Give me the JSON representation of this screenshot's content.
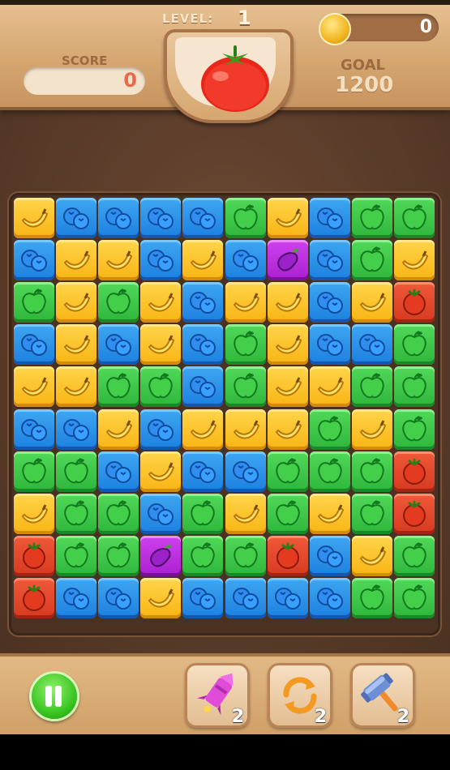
{
  "hud": {
    "level_label": "LEVEL:",
    "level": "1",
    "coins": "0",
    "score_label": "SCORE",
    "score": "0",
    "goal_label": "GOAL",
    "goal": "1200",
    "goal_item": "tomato-icon"
  },
  "board": {
    "columns": 10,
    "rows": 10,
    "legend": {
      "B": "banana",
      "U": "blueberry",
      "A": "apple",
      "T": "tomato",
      "E": "eggplant"
    },
    "colors": {
      "banana": "#f8b413",
      "blueberry": "#1c7fe0",
      "apple": "#2db63b",
      "tomato": "#d63a20",
      "eggplant": "#a91fcf"
    },
    "grid": [
      "BUUUUABUAA",
      "UBBUBUEUAB",
      "ABABUBBUBT",
      "UBUBUABUUA",
      "BBAAUABBAA",
      "UUBUBBBABA",
      "AAUBUUAAAT",
      "BAAUABABAT",
      "TAAEAATUBA",
      "TUUBUUUUAA"
    ]
  },
  "controls": {
    "pause_icon": "pause-icon",
    "boosters": [
      {
        "icon": "rocket-icon",
        "count": "2"
      },
      {
        "icon": "shuffle-icon",
        "count": "2"
      },
      {
        "icon": "hammer-icon",
        "count": "2"
      }
    ]
  }
}
